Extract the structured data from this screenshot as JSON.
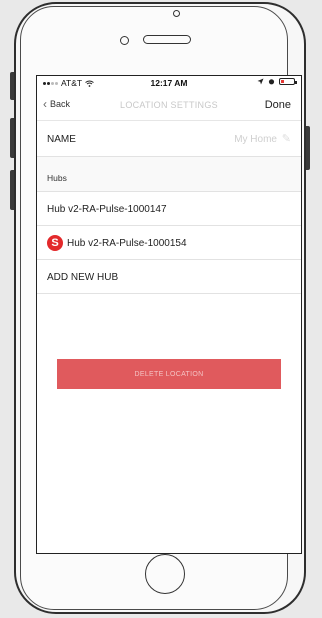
{
  "status_bar": {
    "carrier": "AT&T",
    "time": "12:17 AM"
  },
  "nav": {
    "back_label": "Back",
    "title": "LOCATION SETTINGS",
    "done_label": "Done"
  },
  "name_row": {
    "label": "NAME",
    "value": "My Home"
  },
  "hubs_section": {
    "header": "Hubs",
    "items": [
      {
        "label": "Hub v2-RA-Pulse-1000147",
        "logo": ""
      },
      {
        "label": "Hub v2-RA-Pulse-1000154",
        "logo": "S"
      }
    ]
  },
  "add_hub": {
    "label": "ADD NEW HUB"
  },
  "delete": {
    "label": "DELETE LOCATION"
  },
  "icons": {
    "wifi": "wifi-icon",
    "battery": "battery-icon",
    "location": "location-arrow-icon",
    "alarm": "alarm-icon",
    "edit": "edit-pencil-icon",
    "hub_logo": "s-brand-logo-icon"
  },
  "colors": {
    "delete_button": "#e05a5d",
    "hub_logo": "#e3292b",
    "placeholder_text": "#cfcfcf"
  }
}
